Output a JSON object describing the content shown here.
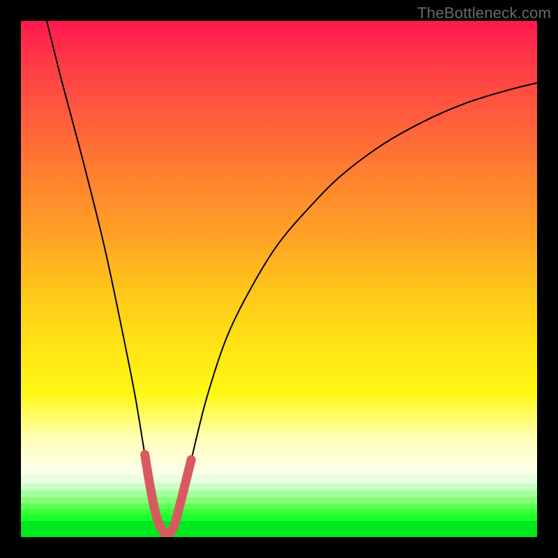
{
  "watermark": "TheBottleneck.com",
  "chart_data": {
    "type": "line",
    "title": "",
    "xlabel": "",
    "ylabel": "",
    "xlim": [
      0,
      100
    ],
    "ylim": [
      0,
      100
    ],
    "grid": false,
    "legend": false,
    "series": [
      {
        "name": "bottleneck-curve",
        "x": [
          5,
          8,
          12,
          16,
          19,
          22,
          24,
          25.5,
          27,
          28.3,
          29.5,
          31,
          33,
          36,
          40,
          45,
          50,
          56,
          62,
          70,
          78,
          86,
          94,
          100
        ],
        "y": [
          100,
          88,
          73,
          57,
          43,
          28,
          16,
          7,
          2,
          0.5,
          2,
          7,
          15,
          27,
          39,
          49,
          57,
          64,
          70,
          76,
          80.5,
          84,
          86.5,
          88
        ]
      },
      {
        "name": "highlight-segment",
        "x": [
          24,
          25,
          26,
          27,
          28.3,
          29.6,
          31,
          32,
          33
        ],
        "y": [
          16,
          10,
          5,
          2,
          0.5,
          2,
          7,
          11,
          15
        ]
      }
    ],
    "gradient_bands": [
      {
        "y_pct": 88.0,
        "h_pct": 1.6,
        "color": "#e8ffe0"
      },
      {
        "y_pct": 89.6,
        "h_pct": 1.4,
        "color": "#c8ffc4"
      },
      {
        "y_pct": 91.0,
        "h_pct": 1.3,
        "color": "#a6ff9e"
      },
      {
        "y_pct": 92.3,
        "h_pct": 1.2,
        "color": "#84ff78"
      },
      {
        "y_pct": 93.5,
        "h_pct": 1.1,
        "color": "#5eff55"
      },
      {
        "y_pct": 94.6,
        "h_pct": 1.1,
        "color": "#38ff3a"
      },
      {
        "y_pct": 95.7,
        "h_pct": 1.2,
        "color": "#18ff2a"
      },
      {
        "y_pct": 96.9,
        "h_pct": 3.1,
        "color": "#00e81f"
      }
    ]
  }
}
